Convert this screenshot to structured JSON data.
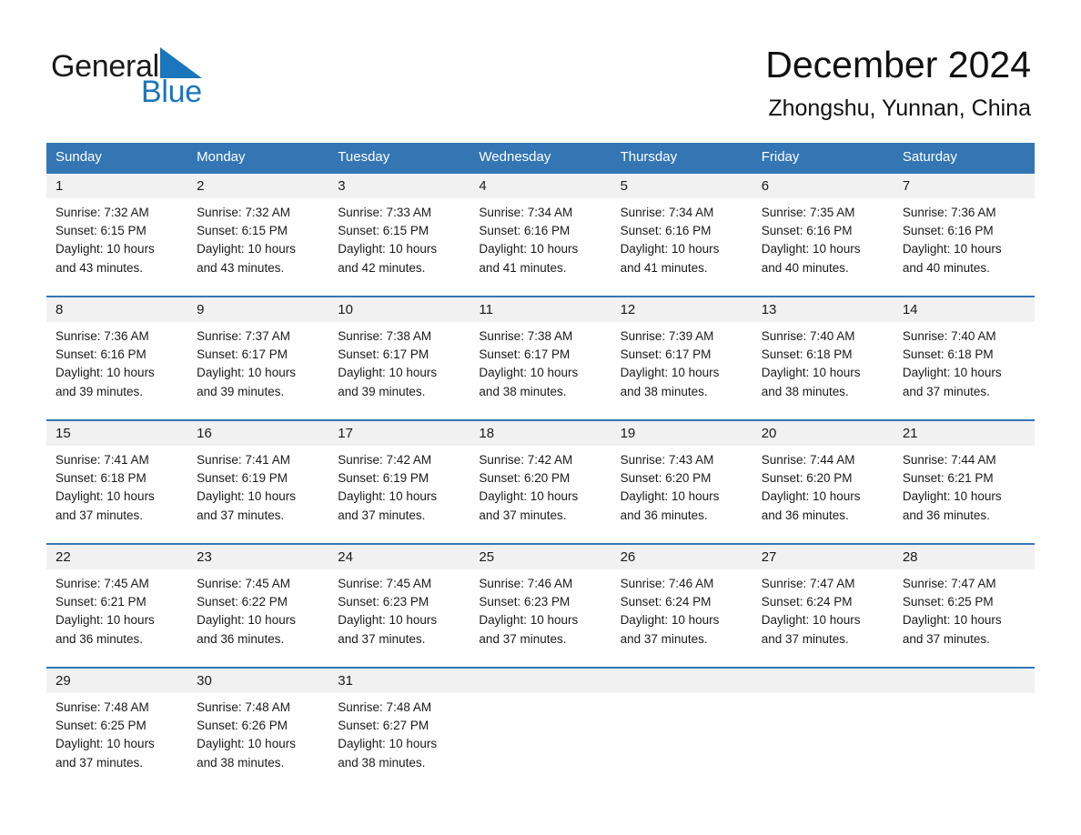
{
  "brand": {
    "word1": "General",
    "word2": "Blue",
    "triangle_color": "#1b76bc",
    "text_color": "#1a1a1a"
  },
  "header": {
    "title": "December 2024",
    "subtitle": "Zhongshu, Yunnan, China"
  },
  "theme": {
    "header_blue": "#3476b4",
    "daynum_band": "#f1f1f1",
    "page_background": "#ffffff",
    "text": "#1a1a1a"
  },
  "weekday_headers": [
    "Sunday",
    "Monday",
    "Tuesday",
    "Wednesday",
    "Thursday",
    "Friday",
    "Saturday"
  ],
  "weeks": [
    [
      {
        "day": "1",
        "sunrise": "Sunrise: 7:32 AM",
        "sunset": "Sunset: 6:15 PM",
        "daylight_line1": "Daylight: 10 hours",
        "daylight_line2": "and 43 minutes."
      },
      {
        "day": "2",
        "sunrise": "Sunrise: 7:32 AM",
        "sunset": "Sunset: 6:15 PM",
        "daylight_line1": "Daylight: 10 hours",
        "daylight_line2": "and 43 minutes."
      },
      {
        "day": "3",
        "sunrise": "Sunrise: 7:33 AM",
        "sunset": "Sunset: 6:15 PM",
        "daylight_line1": "Daylight: 10 hours",
        "daylight_line2": "and 42 minutes."
      },
      {
        "day": "4",
        "sunrise": "Sunrise: 7:34 AM",
        "sunset": "Sunset: 6:16 PM",
        "daylight_line1": "Daylight: 10 hours",
        "daylight_line2": "and 41 minutes."
      },
      {
        "day": "5",
        "sunrise": "Sunrise: 7:34 AM",
        "sunset": "Sunset: 6:16 PM",
        "daylight_line1": "Daylight: 10 hours",
        "daylight_line2": "and 41 minutes."
      },
      {
        "day": "6",
        "sunrise": "Sunrise: 7:35 AM",
        "sunset": "Sunset: 6:16 PM",
        "daylight_line1": "Daylight: 10 hours",
        "daylight_line2": "and 40 minutes."
      },
      {
        "day": "7",
        "sunrise": "Sunrise: 7:36 AM",
        "sunset": "Sunset: 6:16 PM",
        "daylight_line1": "Daylight: 10 hours",
        "daylight_line2": "and 40 minutes."
      }
    ],
    [
      {
        "day": "8",
        "sunrise": "Sunrise: 7:36 AM",
        "sunset": "Sunset: 6:16 PM",
        "daylight_line1": "Daylight: 10 hours",
        "daylight_line2": "and 39 minutes."
      },
      {
        "day": "9",
        "sunrise": "Sunrise: 7:37 AM",
        "sunset": "Sunset: 6:17 PM",
        "daylight_line1": "Daylight: 10 hours",
        "daylight_line2": "and 39 minutes."
      },
      {
        "day": "10",
        "sunrise": "Sunrise: 7:38 AM",
        "sunset": "Sunset: 6:17 PM",
        "daylight_line1": "Daylight: 10 hours",
        "daylight_line2": "and 39 minutes."
      },
      {
        "day": "11",
        "sunrise": "Sunrise: 7:38 AM",
        "sunset": "Sunset: 6:17 PM",
        "daylight_line1": "Daylight: 10 hours",
        "daylight_line2": "and 38 minutes."
      },
      {
        "day": "12",
        "sunrise": "Sunrise: 7:39 AM",
        "sunset": "Sunset: 6:17 PM",
        "daylight_line1": "Daylight: 10 hours",
        "daylight_line2": "and 38 minutes."
      },
      {
        "day": "13",
        "sunrise": "Sunrise: 7:40 AM",
        "sunset": "Sunset: 6:18 PM",
        "daylight_line1": "Daylight: 10 hours",
        "daylight_line2": "and 38 minutes."
      },
      {
        "day": "14",
        "sunrise": "Sunrise: 7:40 AM",
        "sunset": "Sunset: 6:18 PM",
        "daylight_line1": "Daylight: 10 hours",
        "daylight_line2": "and 37 minutes."
      }
    ],
    [
      {
        "day": "15",
        "sunrise": "Sunrise: 7:41 AM",
        "sunset": "Sunset: 6:18 PM",
        "daylight_line1": "Daylight: 10 hours",
        "daylight_line2": "and 37 minutes."
      },
      {
        "day": "16",
        "sunrise": "Sunrise: 7:41 AM",
        "sunset": "Sunset: 6:19 PM",
        "daylight_line1": "Daylight: 10 hours",
        "daylight_line2": "and 37 minutes."
      },
      {
        "day": "17",
        "sunrise": "Sunrise: 7:42 AM",
        "sunset": "Sunset: 6:19 PM",
        "daylight_line1": "Daylight: 10 hours",
        "daylight_line2": "and 37 minutes."
      },
      {
        "day": "18",
        "sunrise": "Sunrise: 7:42 AM",
        "sunset": "Sunset: 6:20 PM",
        "daylight_line1": "Daylight: 10 hours",
        "daylight_line2": "and 37 minutes."
      },
      {
        "day": "19",
        "sunrise": "Sunrise: 7:43 AM",
        "sunset": "Sunset: 6:20 PM",
        "daylight_line1": "Daylight: 10 hours",
        "daylight_line2": "and 36 minutes."
      },
      {
        "day": "20",
        "sunrise": "Sunrise: 7:44 AM",
        "sunset": "Sunset: 6:20 PM",
        "daylight_line1": "Daylight: 10 hours",
        "daylight_line2": "and 36 minutes."
      },
      {
        "day": "21",
        "sunrise": "Sunrise: 7:44 AM",
        "sunset": "Sunset: 6:21 PM",
        "daylight_line1": "Daylight: 10 hours",
        "daylight_line2": "and 36 minutes."
      }
    ],
    [
      {
        "day": "22",
        "sunrise": "Sunrise: 7:45 AM",
        "sunset": "Sunset: 6:21 PM",
        "daylight_line1": "Daylight: 10 hours",
        "daylight_line2": "and 36 minutes."
      },
      {
        "day": "23",
        "sunrise": "Sunrise: 7:45 AM",
        "sunset": "Sunset: 6:22 PM",
        "daylight_line1": "Daylight: 10 hours",
        "daylight_line2": "and 36 minutes."
      },
      {
        "day": "24",
        "sunrise": "Sunrise: 7:45 AM",
        "sunset": "Sunset: 6:23 PM",
        "daylight_line1": "Daylight: 10 hours",
        "daylight_line2": "and 37 minutes."
      },
      {
        "day": "25",
        "sunrise": "Sunrise: 7:46 AM",
        "sunset": "Sunset: 6:23 PM",
        "daylight_line1": "Daylight: 10 hours",
        "daylight_line2": "and 37 minutes."
      },
      {
        "day": "26",
        "sunrise": "Sunrise: 7:46 AM",
        "sunset": "Sunset: 6:24 PM",
        "daylight_line1": "Daylight: 10 hours",
        "daylight_line2": "and 37 minutes."
      },
      {
        "day": "27",
        "sunrise": "Sunrise: 7:47 AM",
        "sunset": "Sunset: 6:24 PM",
        "daylight_line1": "Daylight: 10 hours",
        "daylight_line2": "and 37 minutes."
      },
      {
        "day": "28",
        "sunrise": "Sunrise: 7:47 AM",
        "sunset": "Sunset: 6:25 PM",
        "daylight_line1": "Daylight: 10 hours",
        "daylight_line2": "and 37 minutes."
      }
    ],
    [
      {
        "day": "29",
        "sunrise": "Sunrise: 7:48 AM",
        "sunset": "Sunset: 6:25 PM",
        "daylight_line1": "Daylight: 10 hours",
        "daylight_line2": "and 37 minutes."
      },
      {
        "day": "30",
        "sunrise": "Sunrise: 7:48 AM",
        "sunset": "Sunset: 6:26 PM",
        "daylight_line1": "Daylight: 10 hours",
        "daylight_line2": "and 38 minutes."
      },
      {
        "day": "31",
        "sunrise": "Sunrise: 7:48 AM",
        "sunset": "Sunset: 6:27 PM",
        "daylight_line1": "Daylight: 10 hours",
        "daylight_line2": "and 38 minutes."
      },
      {
        "day": "",
        "sunrise": "",
        "sunset": "",
        "daylight_line1": "",
        "daylight_line2": ""
      },
      {
        "day": "",
        "sunrise": "",
        "sunset": "",
        "daylight_line1": "",
        "daylight_line2": ""
      },
      {
        "day": "",
        "sunrise": "",
        "sunset": "",
        "daylight_line1": "",
        "daylight_line2": ""
      },
      {
        "day": "",
        "sunrise": "",
        "sunset": "",
        "daylight_line1": "",
        "daylight_line2": ""
      }
    ]
  ]
}
